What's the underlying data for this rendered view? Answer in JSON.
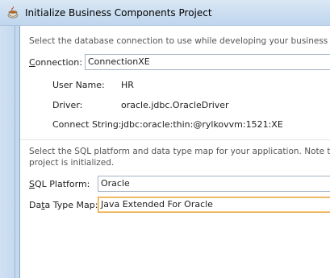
{
  "window": {
    "title": "Initialize Business Components Project",
    "icon": "coffee-cup-icon"
  },
  "connection_section": {
    "description": "Select the database connection to use while developing your business compor",
    "connection_label_prefix": "C",
    "connection_label_rest": "onnection:",
    "connection_value": "ConnectionXE",
    "user_name_label": "User Name:",
    "user_name_value": "HR",
    "driver_label": "Driver:",
    "driver_value": "oracle.jdbc.OracleDriver",
    "connect_string_label": "Connect String:",
    "connect_string_value": "jdbc:oracle:thin:@rylkovvm:1521:XE"
  },
  "platform_section": {
    "description_line1": "Select the SQL platform and data type map for your application.  Note that th",
    "description_line2": "project is initialized.",
    "sql_platform_label_prefix": "S",
    "sql_platform_label_rest": "QL Platform:",
    "sql_platform_value": "Oracle",
    "data_type_map_label_pre": "Da",
    "data_type_map_label_u": "t",
    "data_type_map_label_rest": "a Type Map:",
    "data_type_map_value": "Java Extended For Oracle"
  },
  "colors": {
    "titlebar": "#c9dcf0",
    "focus_border": "#e8a33c",
    "field_border": "#a6b3c4"
  }
}
